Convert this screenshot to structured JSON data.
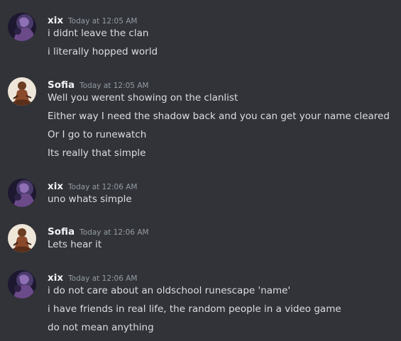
{
  "messages": [
    {
      "username": "xix",
      "timestamp": "Today at 12:05 AM",
      "avatar": "xix-avatar",
      "lines": [
        "i didnt leave the clan",
        "i literally hopped world"
      ]
    },
    {
      "username": "Sofia",
      "timestamp": "Today at 12:05 AM",
      "avatar": "sofia-avatar",
      "lines": [
        "Well you werent showing on the clanlist",
        "Either way I need the shadow back and you can get your name cleared",
        "Or I go to runewatch",
        "Its really that simple"
      ]
    },
    {
      "username": "xix",
      "timestamp": "Today at 12:06 AM",
      "avatar": "xix-avatar",
      "lines": [
        "uno whats simple"
      ]
    },
    {
      "username": "Sofia",
      "timestamp": "Today at 12:06 AM",
      "avatar": "sofia-avatar",
      "lines": [
        "Lets hear it"
      ]
    },
    {
      "username": "xix",
      "timestamp": "Today at 12:06 AM",
      "avatar": "xix-avatar",
      "lines": [
        "i do not care about an oldschool runescape 'name'",
        "i have friends in real life, the random people in a video game",
        "do not mean anything"
      ]
    }
  ],
  "colors": {
    "background": "#313338",
    "username": "#f2f3f5",
    "message_text": "#dbdee1",
    "timestamp": "#949ba4"
  }
}
